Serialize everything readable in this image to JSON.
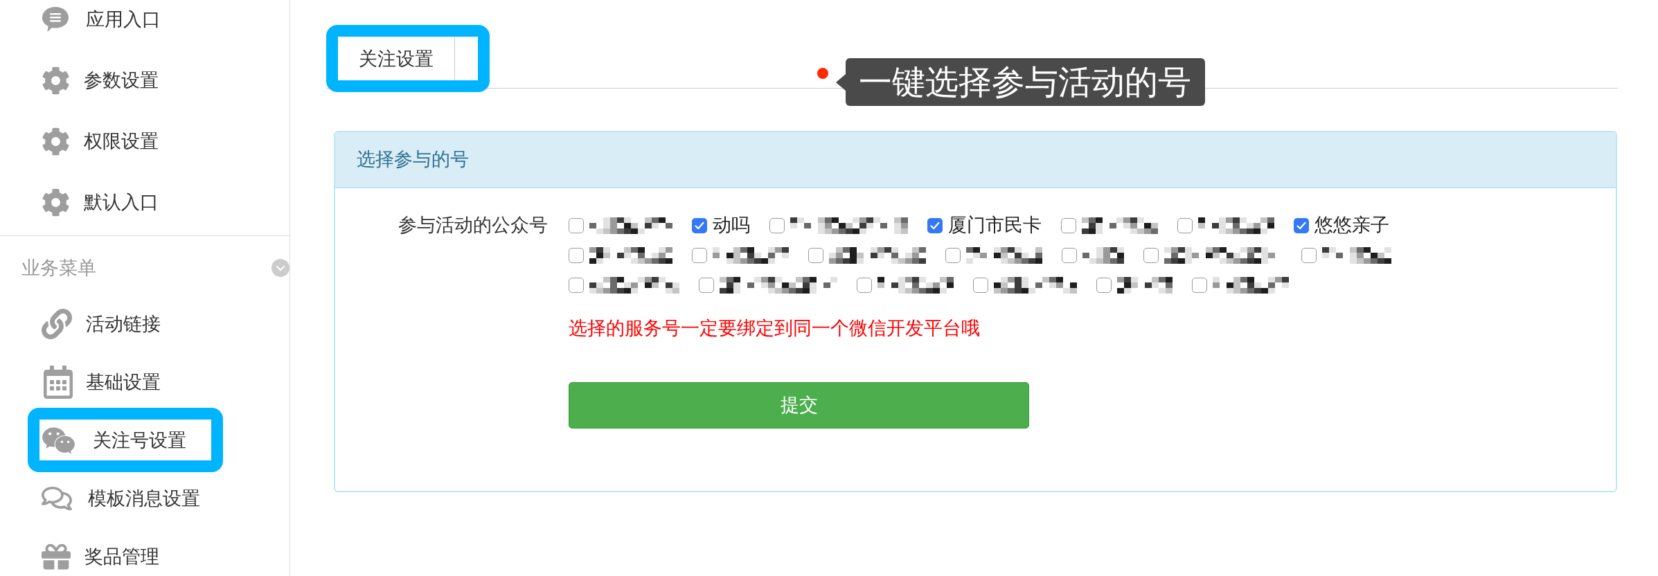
{
  "sidebar": {
    "groups": [
      {
        "items": [
          {
            "label": "应用入口",
            "highlighted": false
          },
          {
            "label": "参数设置",
            "highlighted": false
          },
          {
            "label": "权限设置",
            "highlighted": false
          },
          {
            "label": "默认入口",
            "highlighted": false
          }
        ]
      },
      {
        "title": "业务菜单",
        "items": [
          {
            "label": "活动链接",
            "highlighted": false
          },
          {
            "label": "基础设置",
            "highlighted": false
          },
          {
            "label": "关注号设置",
            "highlighted": true
          },
          {
            "label": "模板消息设置",
            "highlighted": false
          },
          {
            "label": "奖品管理",
            "highlighted": false
          }
        ]
      }
    ]
  },
  "tabs": [
    {
      "label": "关注设置",
      "highlighted": true
    }
  ],
  "annotation": {
    "text": "一键选择参与活动的号"
  },
  "panel": {
    "title": "选择参与的号",
    "field_label": "参与活动的公众号",
    "accounts": [
      {
        "kind": "redacted",
        "checked": false
      },
      {
        "kind": "text",
        "label": "动吗",
        "checked": true
      },
      {
        "kind": "redacted",
        "checked": false
      },
      {
        "kind": "text",
        "label": "厦门市民卡",
        "checked": true
      },
      {
        "kind": "redacted",
        "checked": false
      },
      {
        "kind": "redacted",
        "checked": false
      },
      {
        "kind": "text",
        "label": "悠悠亲子",
        "checked": true
      },
      {
        "kind": "redacted",
        "checked": false
      },
      {
        "kind": "redacted",
        "checked": false
      },
      {
        "kind": "redacted",
        "checked": false
      },
      {
        "kind": "redacted",
        "checked": false
      },
      {
        "kind": "redacted",
        "checked": false
      },
      {
        "kind": "redacted",
        "checked": false
      },
      {
        "kind": "redacted",
        "checked": false
      },
      {
        "kind": "redacted",
        "checked": false
      },
      {
        "kind": "redacted",
        "checked": false
      },
      {
        "kind": "redacted",
        "checked": false
      },
      {
        "kind": "redacted",
        "checked": false
      },
      {
        "kind": "redacted",
        "checked": false
      },
      {
        "kind": "redacted",
        "checked": false
      }
    ],
    "warning": "选择的服务号一定要绑定到同一个微信开发平台哦",
    "submit": "提交"
  }
}
